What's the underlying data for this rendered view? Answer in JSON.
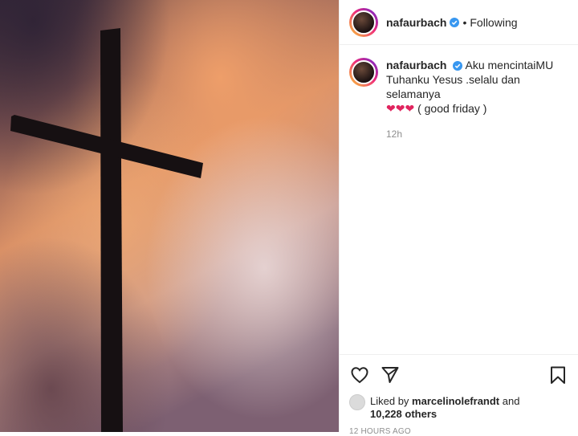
{
  "post": {
    "username": "nafaurbach",
    "follow_separator": "•",
    "follow_status": "Following"
  },
  "caption": {
    "username": "nafaurbach",
    "text_line1": "Aku mencintaiMU",
    "text_line2": "Tuhanku Yesus .selalu dan selamanya",
    "hearts": "❤❤❤",
    "text_suffix": " ( good friday )",
    "time": "12h"
  },
  "likes": {
    "prefix": "Liked by ",
    "liker": "marcelinolefrandt",
    "middle": " and",
    "count_text": "10,228 others"
  },
  "posted_ago": "12 HOURS AGO",
  "colors": {
    "verified": "#3897f0",
    "accent_text": "#262626",
    "muted_text": "#8e8e8e",
    "heart": "#e0245e"
  },
  "icons": [
    "like-heart-icon",
    "share-paper-plane-icon",
    "save-bookmark-icon",
    "verified-badge-icon"
  ]
}
